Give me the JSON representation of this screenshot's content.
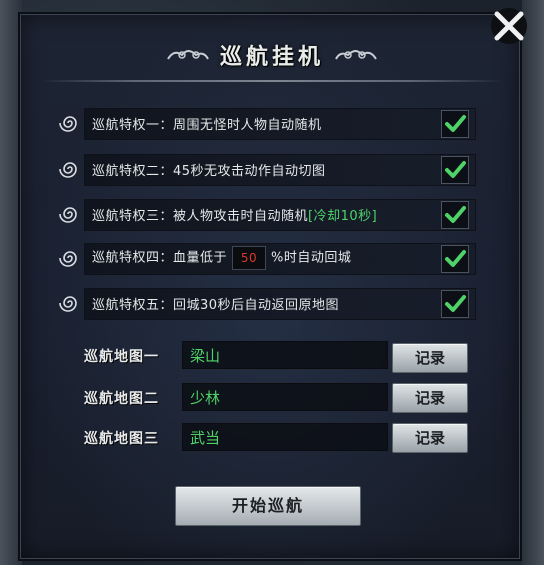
{
  "title": "巡航挂机",
  "privileges": [
    {
      "label": "巡航特权一：周围无怪时人物自动随机",
      "checked": true
    },
    {
      "label": "巡航特权二：45秒无攻击动作自动切图",
      "checked": true
    },
    {
      "label": "巡航特权三：被人物攻击时自动随机",
      "note": "[冷却10秒]",
      "checked": true
    },
    {
      "label_before": "巡航特权四：血量低于",
      "value": "50",
      "label_after": "%时自动回城",
      "checked": true
    },
    {
      "label": "巡航特权五：回城30秒后自动返回原地图",
      "checked": true
    }
  ],
  "routes": [
    {
      "label": "巡航地图一",
      "value": "梁山",
      "button": "记录"
    },
    {
      "label": "巡航地图二",
      "value": "少林",
      "button": "记录"
    },
    {
      "label": "巡航地图三",
      "value": "武当",
      "button": "记录"
    }
  ],
  "start_button": "开始巡航",
  "colors": {
    "checkmark": "#4fd268",
    "field_text": "#4fd268",
    "hp_value": "#d83a2a"
  },
  "icons": {
    "close": "close-x-icon",
    "privilege": "spiral-icon",
    "check": "checkmark-icon",
    "title_ornament": "cloud-ornament-icon"
  }
}
